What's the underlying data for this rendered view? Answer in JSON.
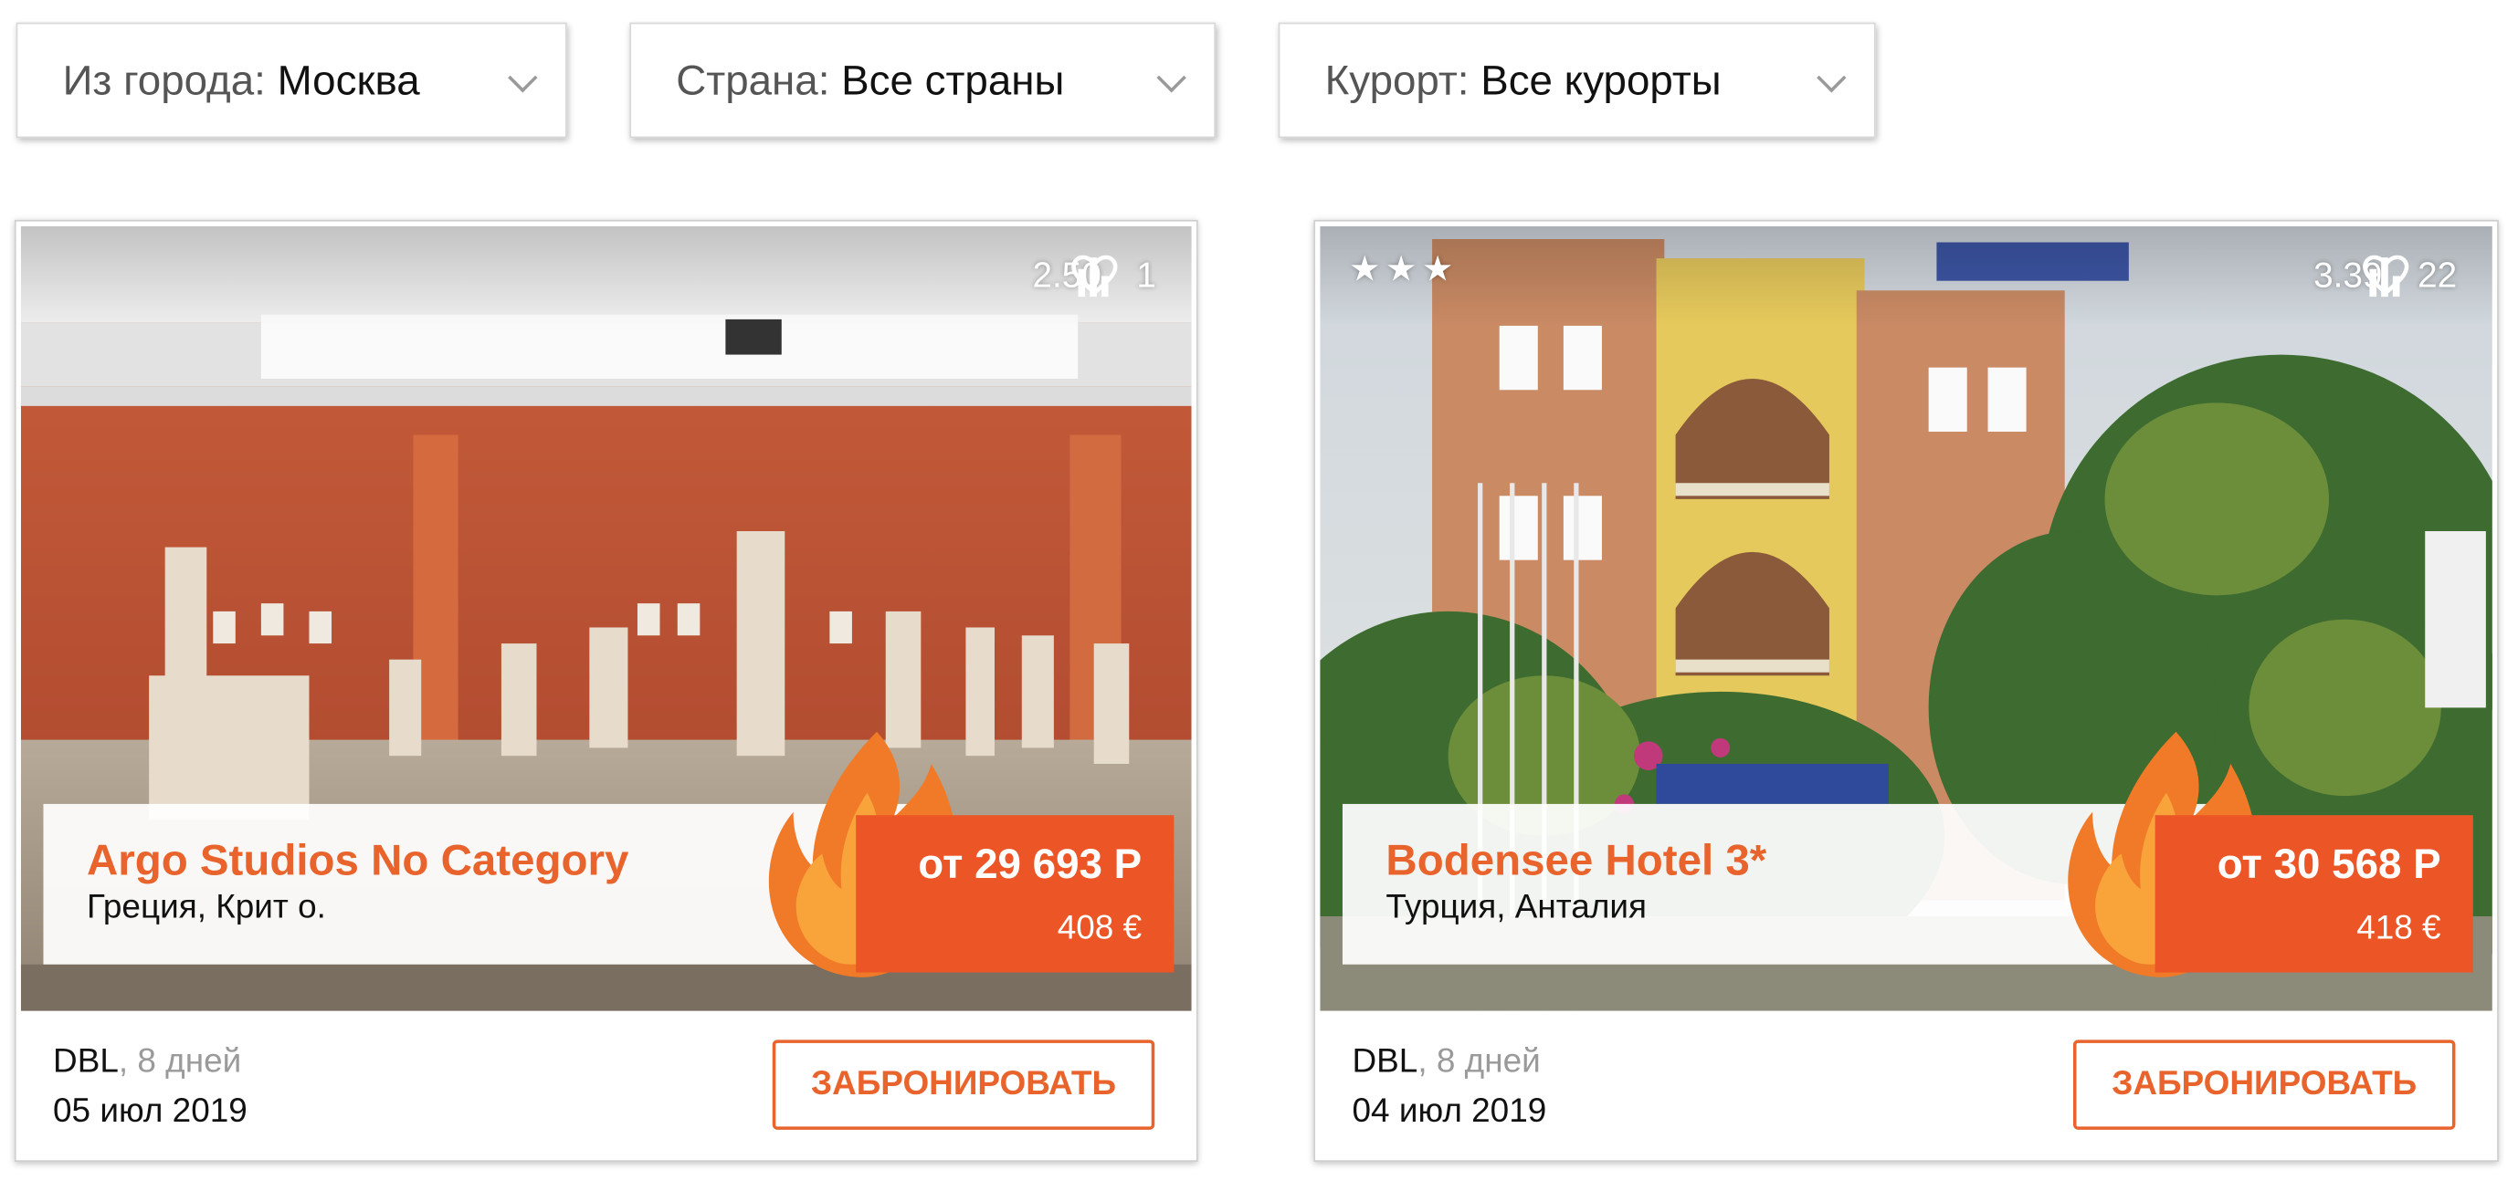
{
  "filters": {
    "city": {
      "label": "Из города:",
      "value": "Москва"
    },
    "country": {
      "label": "Страна:",
      "value": "Все страны"
    },
    "resort": {
      "label": "Курорт:",
      "value": "Все курорты"
    }
  },
  "cards": [
    {
      "stars": "",
      "rating": "2.50",
      "likes": "1",
      "name": "Argo Studios No Category",
      "location": "Греция, Крит о.",
      "price": "от 29 693 Р",
      "price_eur": "408 €",
      "room": "DBL",
      "days": ", 8 дней",
      "date": "05 июл 2019",
      "book_label": "ЗАБРОНИРОВАТЬ"
    },
    {
      "stars": "★★★",
      "rating": "3.39",
      "likes": "22",
      "name": "Bodensee Hotel 3*",
      "location": "Турция, Анталия",
      "price": "от 30 568 Р",
      "price_eur": "418 €",
      "room": "DBL",
      "days": ", 8 дней",
      "date": "04 июл 2019",
      "book_label": "ЗАБРОНИРОВАТЬ"
    }
  ],
  "colors": {
    "accent": "#e8642c",
    "price_bg": "#ec5626"
  },
  "icons": [
    "rating-bars-icon",
    "heart-icon",
    "chevron-down-icon",
    "flame-icon",
    "star-icon"
  ]
}
